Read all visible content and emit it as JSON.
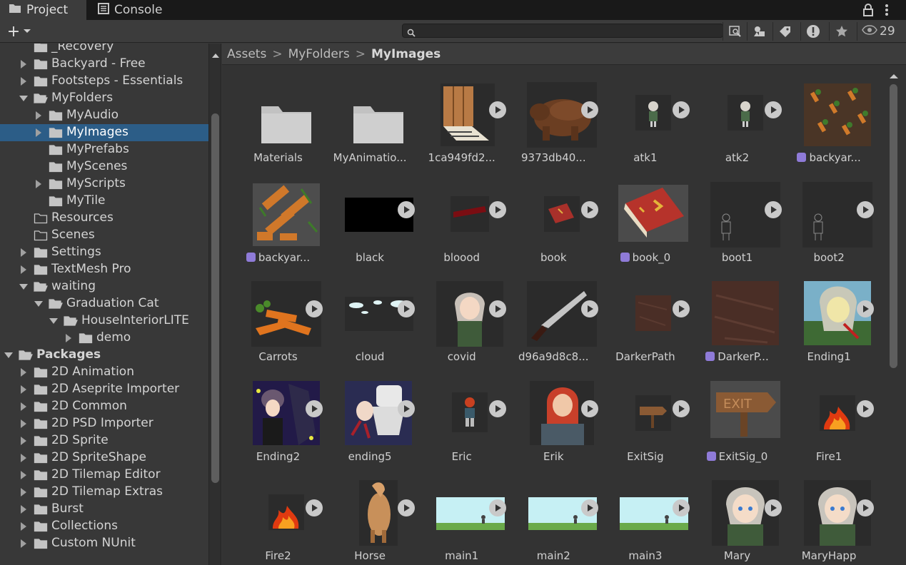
{
  "tabs": [
    {
      "label": "Project",
      "icon": "folder-icon"
    },
    {
      "label": "Console",
      "icon": "console-icon"
    }
  ],
  "toolbar": {
    "add_label": "+",
    "search_placeholder": "",
    "visibility_count": "29"
  },
  "breadcrumb": [
    {
      "label": "Assets"
    },
    {
      "label": "MyFolders"
    },
    {
      "label": "MyImages"
    }
  ],
  "tree": [
    {
      "label": "_Recovery",
      "depth": 1,
      "arrow": "none",
      "open": false,
      "selected": false,
      "empty": false
    },
    {
      "label": "Backyard - Free",
      "depth": 1,
      "arrow": "right",
      "open": false,
      "selected": false,
      "empty": false
    },
    {
      "label": "Footsteps - Essentials",
      "depth": 1,
      "arrow": "right",
      "open": false,
      "selected": false,
      "empty": false
    },
    {
      "label": "MyFolders",
      "depth": 1,
      "arrow": "down",
      "open": true,
      "selected": false,
      "empty": false
    },
    {
      "label": "MyAudio",
      "depth": 2,
      "arrow": "right",
      "open": false,
      "selected": false,
      "empty": false
    },
    {
      "label": "MyImages",
      "depth": 2,
      "arrow": "right",
      "open": false,
      "selected": true,
      "empty": false
    },
    {
      "label": "MyPrefabs",
      "depth": 2,
      "arrow": "none",
      "open": false,
      "selected": false,
      "empty": false
    },
    {
      "label": "MyScenes",
      "depth": 2,
      "arrow": "none",
      "open": false,
      "selected": false,
      "empty": false
    },
    {
      "label": "MyScripts",
      "depth": 2,
      "arrow": "right",
      "open": false,
      "selected": false,
      "empty": false
    },
    {
      "label": "MyTile",
      "depth": 2,
      "arrow": "none",
      "open": false,
      "selected": false,
      "empty": false
    },
    {
      "label": "Resources",
      "depth": 1,
      "arrow": "none",
      "open": false,
      "selected": false,
      "empty": true
    },
    {
      "label": "Scenes",
      "depth": 1,
      "arrow": "none",
      "open": false,
      "selected": false,
      "empty": true
    },
    {
      "label": "Settings",
      "depth": 1,
      "arrow": "right",
      "open": false,
      "selected": false,
      "empty": false
    },
    {
      "label": "TextMesh Pro",
      "depth": 1,
      "arrow": "right",
      "open": false,
      "selected": false,
      "empty": false
    },
    {
      "label": "waiting",
      "depth": 1,
      "arrow": "down",
      "open": true,
      "selected": false,
      "empty": false
    },
    {
      "label": "Graduation Cat",
      "depth": 2,
      "arrow": "down",
      "open": true,
      "selected": false,
      "empty": false
    },
    {
      "label": "HouseInteriorLITE",
      "depth": 3,
      "arrow": "down",
      "open": true,
      "selected": false,
      "empty": false
    },
    {
      "label": "demo",
      "depth": 4,
      "arrow": "right",
      "open": false,
      "selected": false,
      "empty": false
    },
    {
      "label": "Packages",
      "depth": 0,
      "arrow": "down",
      "open": true,
      "selected": false,
      "empty": false,
      "bold": true
    },
    {
      "label": "2D Animation",
      "depth": 1,
      "arrow": "right",
      "open": false,
      "selected": false,
      "empty": false
    },
    {
      "label": "2D Aseprite Importer",
      "depth": 1,
      "arrow": "right",
      "open": false,
      "selected": false,
      "empty": false
    },
    {
      "label": "2D Common",
      "depth": 1,
      "arrow": "right",
      "open": false,
      "selected": false,
      "empty": false
    },
    {
      "label": "2D PSD Importer",
      "depth": 1,
      "arrow": "right",
      "open": false,
      "selected": false,
      "empty": false
    },
    {
      "label": "2D Sprite",
      "depth": 1,
      "arrow": "right",
      "open": false,
      "selected": false,
      "empty": false
    },
    {
      "label": "2D SpriteShape",
      "depth": 1,
      "arrow": "right",
      "open": false,
      "selected": false,
      "empty": false
    },
    {
      "label": "2D Tilemap Editor",
      "depth": 1,
      "arrow": "right",
      "open": false,
      "selected": false,
      "empty": false
    },
    {
      "label": "2D Tilemap Extras",
      "depth": 1,
      "arrow": "right",
      "open": false,
      "selected": false,
      "empty": false
    },
    {
      "label": "Burst",
      "depth": 1,
      "arrow": "right",
      "open": false,
      "selected": false,
      "empty": false
    },
    {
      "label": "Collections",
      "depth": 1,
      "arrow": "right",
      "open": false,
      "selected": false,
      "empty": false
    },
    {
      "label": "Custom NUnit",
      "depth": 1,
      "arrow": "right",
      "open": false,
      "selected": false,
      "empty": false
    }
  ],
  "assets": [
    {
      "label": "Materials",
      "kind": "folder",
      "play": false,
      "sub": false
    },
    {
      "label": "MyAnimatio...",
      "kind": "folder",
      "play": false,
      "sub": false
    },
    {
      "label": "1ca949fd2...",
      "kind": "crate",
      "play": true,
      "sub": false
    },
    {
      "label": "9373db40...",
      "kind": "bear",
      "play": true,
      "sub": false
    },
    {
      "label": "atk1",
      "kind": "sprite-small",
      "play": true,
      "sub": false
    },
    {
      "label": "atk2",
      "kind": "sprite-small",
      "play": true,
      "sub": false
    },
    {
      "label": "backyar...",
      "kind": "carrots-field",
      "play": false,
      "sub": true
    },
    {
      "label": "backyar...",
      "kind": "carrots-tiles",
      "play": false,
      "sub": true
    },
    {
      "label": "black",
      "kind": "black",
      "play": true,
      "sub": false
    },
    {
      "label": "bloood",
      "kind": "blood",
      "play": true,
      "sub": false
    },
    {
      "label": "book",
      "kind": "book-small",
      "play": true,
      "sub": false
    },
    {
      "label": "book_0",
      "kind": "book",
      "play": false,
      "sub": true
    },
    {
      "label": "boot1",
      "kind": "outline",
      "play": true,
      "sub": false
    },
    {
      "label": "boot2",
      "kind": "outline",
      "play": true,
      "sub": false
    },
    {
      "label": "Carrots",
      "kind": "carrots",
      "play": true,
      "sub": false
    },
    {
      "label": "cloud",
      "kind": "cloud",
      "play": true,
      "sub": false
    },
    {
      "label": "covid",
      "kind": "girl",
      "play": true,
      "sub": false
    },
    {
      "label": "d96a9d8c8...",
      "kind": "knife",
      "play": true,
      "sub": false
    },
    {
      "label": "DarkerPath",
      "kind": "path-small",
      "play": true,
      "sub": false
    },
    {
      "label": "DarkerP...",
      "kind": "path",
      "play": false,
      "sub": true
    },
    {
      "label": "Ending1",
      "kind": "ending1",
      "play": true,
      "sub": false
    },
    {
      "label": "Ending2",
      "kind": "ending2",
      "play": true,
      "sub": false
    },
    {
      "label": "ending5",
      "kind": "ending5",
      "play": true,
      "sub": false
    },
    {
      "label": "Eric",
      "kind": "eric",
      "play": true,
      "sub": false
    },
    {
      "label": "Erik",
      "kind": "erik",
      "play": true,
      "sub": false
    },
    {
      "label": "ExitSig",
      "kind": "exit-small",
      "play": true,
      "sub": false
    },
    {
      "label": "ExitSig_0",
      "kind": "exit",
      "play": false,
      "sub": true
    },
    {
      "label": "Fire1",
      "kind": "fire",
      "play": true,
      "sub": false
    },
    {
      "label": "Fire2",
      "kind": "fire",
      "play": true,
      "sub": false
    },
    {
      "label": "Horse",
      "kind": "horse",
      "play": true,
      "sub": false
    },
    {
      "label": "main1",
      "kind": "sky",
      "play": true,
      "sub": false
    },
    {
      "label": "main2",
      "kind": "sky",
      "play": true,
      "sub": false
    },
    {
      "label": "main3",
      "kind": "sky",
      "play": true,
      "sub": false
    },
    {
      "label": "Mary",
      "kind": "mary",
      "play": true,
      "sub": false
    },
    {
      "label": "MaryHapp",
      "kind": "mary",
      "play": true,
      "sub": false
    }
  ],
  "colors": {
    "selection": "#2c5d87",
    "play_button": "#c9c9c9",
    "sub_asset": "#8f7bd8"
  }
}
